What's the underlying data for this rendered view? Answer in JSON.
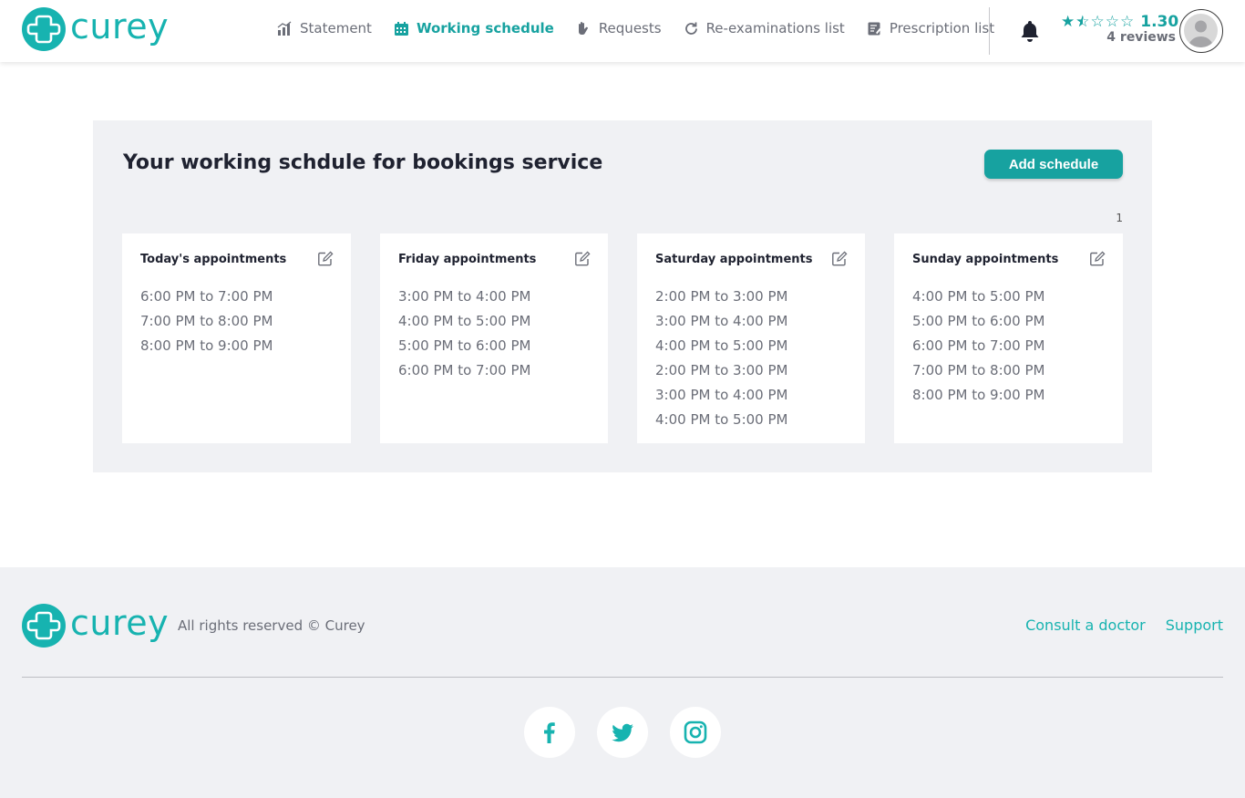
{
  "brand": {
    "name": "curey",
    "color": "#17b3b0"
  },
  "nav": {
    "items": [
      {
        "label": "Statement",
        "icon": "bar-chart-icon",
        "active": false
      },
      {
        "label": "Working schedule",
        "icon": "calendar-icon",
        "active": true
      },
      {
        "label": "Requests",
        "icon": "hand-icon",
        "active": false
      },
      {
        "label": "Re-examinations list",
        "icon": "refresh-icon",
        "active": false
      },
      {
        "label": "Prescription list",
        "icon": "prescription-icon",
        "active": false
      }
    ]
  },
  "user": {
    "rating_value": "1.30",
    "rating_stars": 1.5,
    "reviews": "4 reviews",
    "notification_icon": "bell-icon",
    "avatar_icon": "user-avatar-icon"
  },
  "schedule": {
    "title": "Your working schdule for bookings service",
    "add_button": "Add schedule",
    "page_number": "1",
    "cards": [
      {
        "title": "Today's appointments",
        "slots": [
          "6:00 PM to 7:00 PM",
          "7:00 PM to 8:00 PM",
          "8:00 PM to 9:00 PM"
        ]
      },
      {
        "title": "Friday appointments",
        "slots": [
          "3:00 PM to 4:00 PM",
          "4:00 PM to 5:00 PM",
          "5:00 PM to 6:00 PM",
          "6:00 PM to 7:00 PM"
        ]
      },
      {
        "title": "Saturday appointments",
        "slots": [
          "2:00 PM to 3:00 PM",
          "3:00 PM to 4:00 PM",
          "4:00 PM to 5:00 PM",
          "2:00 PM to 3:00 PM",
          "3:00 PM to 4:00 PM",
          "4:00 PM to 5:00 PM"
        ]
      },
      {
        "title": "Sunday appointments",
        "slots": [
          "4:00 PM to 5:00 PM",
          "5:00 PM to 6:00 PM",
          "6:00 PM to 7:00 PM",
          "7:00 PM to 8:00 PM",
          "8:00 PM to 9:00 PM"
        ]
      }
    ]
  },
  "footer": {
    "copyright": "All rights reserved © Curey",
    "links": [
      "Consult a doctor",
      "Support"
    ],
    "social": [
      "facebook-icon",
      "twitter-icon",
      "instagram-icon"
    ]
  },
  "colors": {
    "accent": "#17a2a0",
    "panel": "#f0f1f4",
    "muted_text": "#6b6e78"
  }
}
